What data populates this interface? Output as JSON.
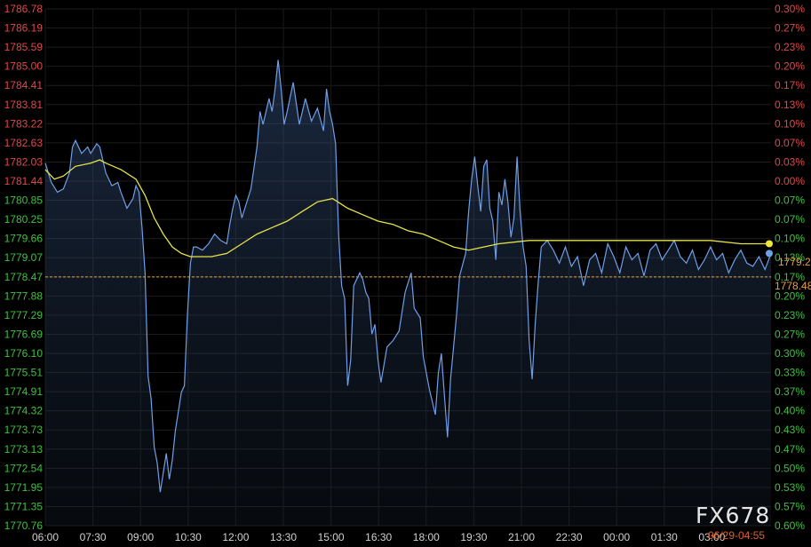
{
  "watermark": "FX678",
  "timestamp": "06/29-04:55",
  "chart_data": {
    "type": "line",
    "xlim": [
      0,
      24
    ],
    "ylim": [
      1770.76,
      1786.78
    ],
    "x_ticks": [
      "06:00",
      "07:30",
      "09:00",
      "10:30",
      "12:00",
      "13:30",
      "15:00",
      "16:30",
      "18:00",
      "19:30",
      "21:00",
      "22:30",
      "00:00",
      "01:30",
      "03:00"
    ],
    "y_ticks_left": [
      "1786.78",
      "1786.19",
      "1785.59",
      "1785.00",
      "1784.41",
      "1783.81",
      "1783.22",
      "1782.63",
      "1782.03",
      "1781.44",
      "1780.85",
      "1780.25",
      "1779.66",
      "1779.07",
      "1778.47",
      "1777.88",
      "1777.29",
      "1776.69",
      "1776.10",
      "1775.51",
      "1774.91",
      "1774.32",
      "1773.73",
      "1773.13",
      "1772.54",
      "1771.95",
      "1771.35",
      "1770.76"
    ],
    "y_ticks_right": [
      "0.30%",
      "0.27%",
      "0.23%",
      "0.20%",
      "0.17%",
      "0.13%",
      "0.10%",
      "0.07%",
      "0.03%",
      "0.00%",
      "0.07%",
      "0.07%",
      "0.10%",
      "0.13%",
      "0.17%",
      "0.20%",
      "0.23%",
      "0.27%",
      "0.30%",
      "0.33%",
      "0.37%",
      "0.40%",
      "0.43%",
      "0.47%",
      "0.50%",
      "0.53%",
      "0.57%",
      "0.60%"
    ],
    "reference_price": 1778.47,
    "reference_label": "1778.48",
    "last_price_label": "1779.2",
    "series": [
      {
        "values": [
          [
            0.0,
            1782.0
          ],
          [
            0.2,
            1781.4
          ],
          [
            0.4,
            1781.1
          ],
          [
            0.6,
            1781.2
          ],
          [
            0.8,
            1781.7
          ],
          [
            0.9,
            1782.5
          ],
          [
            1.0,
            1782.7
          ],
          [
            1.2,
            1782.3
          ],
          [
            1.4,
            1782.5
          ],
          [
            1.5,
            1782.3
          ],
          [
            1.7,
            1782.6
          ],
          [
            1.8,
            1782.5
          ],
          [
            2.0,
            1781.7
          ],
          [
            2.2,
            1781.3
          ],
          [
            2.4,
            1781.4
          ],
          [
            2.5,
            1781.1
          ],
          [
            2.7,
            1780.6
          ],
          [
            2.9,
            1780.9
          ],
          [
            3.0,
            1781.3
          ],
          [
            3.1,
            1781.1
          ],
          [
            3.2,
            1780.0
          ],
          [
            3.3,
            1778.6
          ],
          [
            3.4,
            1775.4
          ],
          [
            3.5,
            1774.7
          ],
          [
            3.6,
            1773.2
          ],
          [
            3.7,
            1772.7
          ],
          [
            3.8,
            1771.8
          ],
          [
            3.9,
            1772.4
          ],
          [
            4.0,
            1773.0
          ],
          [
            4.1,
            1772.2
          ],
          [
            4.2,
            1772.8
          ],
          [
            4.3,
            1773.7
          ],
          [
            4.4,
            1774.3
          ],
          [
            4.5,
            1774.9
          ],
          [
            4.6,
            1775.1
          ],
          [
            4.7,
            1777.3
          ],
          [
            4.8,
            1778.9
          ],
          [
            4.9,
            1779.4
          ],
          [
            5.0,
            1779.4
          ],
          [
            5.2,
            1779.3
          ],
          [
            5.4,
            1779.5
          ],
          [
            5.6,
            1779.8
          ],
          [
            5.8,
            1779.6
          ],
          [
            6.0,
            1779.5
          ],
          [
            6.1,
            1780.1
          ],
          [
            6.2,
            1780.6
          ],
          [
            6.3,
            1781.0
          ],
          [
            6.4,
            1780.8
          ],
          [
            6.5,
            1780.3
          ],
          [
            6.6,
            1780.6
          ],
          [
            6.8,
            1781.2
          ],
          [
            7.0,
            1782.5
          ],
          [
            7.1,
            1783.6
          ],
          [
            7.2,
            1783.2
          ],
          [
            7.4,
            1784.0
          ],
          [
            7.5,
            1783.6
          ],
          [
            7.6,
            1784.3
          ],
          [
            7.7,
            1785.2
          ],
          [
            7.8,
            1784.3
          ],
          [
            7.9,
            1783.2
          ],
          [
            8.0,
            1783.6
          ],
          [
            8.2,
            1784.5
          ],
          [
            8.4,
            1783.2
          ],
          [
            8.6,
            1784.0
          ],
          [
            8.8,
            1783.3
          ],
          [
            9.0,
            1783.7
          ],
          [
            9.2,
            1783.0
          ],
          [
            9.3,
            1784.3
          ],
          [
            9.4,
            1783.6
          ],
          [
            9.5,
            1783.2
          ],
          [
            9.6,
            1782.6
          ],
          [
            9.7,
            1779.8
          ],
          [
            9.8,
            1778.2
          ],
          [
            9.9,
            1777.8
          ],
          [
            10.0,
            1775.1
          ],
          [
            10.1,
            1775.9
          ],
          [
            10.2,
            1778.2
          ],
          [
            10.4,
            1778.6
          ],
          [
            10.5,
            1778.4
          ],
          [
            10.6,
            1778.0
          ],
          [
            10.7,
            1777.8
          ],
          [
            10.8,
            1776.7
          ],
          [
            10.9,
            1777.0
          ],
          [
            11.0,
            1775.9
          ],
          [
            11.1,
            1775.2
          ],
          [
            11.3,
            1776.3
          ],
          [
            11.5,
            1776.5
          ],
          [
            11.7,
            1776.8
          ],
          [
            11.9,
            1778.0
          ],
          [
            12.1,
            1778.6
          ],
          [
            12.2,
            1777.5
          ],
          [
            12.4,
            1777.2
          ],
          [
            12.5,
            1776.0
          ],
          [
            12.7,
            1775.0
          ],
          [
            12.9,
            1774.2
          ],
          [
            13.0,
            1775.5
          ],
          [
            13.1,
            1776.1
          ],
          [
            13.2,
            1774.8
          ],
          [
            13.3,
            1773.5
          ],
          [
            13.4,
            1775.3
          ],
          [
            13.5,
            1776.3
          ],
          [
            13.6,
            1777.3
          ],
          [
            13.7,
            1778.5
          ],
          [
            13.9,
            1779.2
          ],
          [
            14.0,
            1780.5
          ],
          [
            14.1,
            1781.5
          ],
          [
            14.2,
            1782.2
          ],
          [
            14.3,
            1781.3
          ],
          [
            14.4,
            1780.5
          ],
          [
            14.5,
            1781.9
          ],
          [
            14.6,
            1782.1
          ],
          [
            14.7,
            1780.6
          ],
          [
            14.8,
            1780.2
          ],
          [
            14.9,
            1779.0
          ],
          [
            15.0,
            1781.1
          ],
          [
            15.1,
            1780.7
          ],
          [
            15.2,
            1781.5
          ],
          [
            15.3,
            1780.8
          ],
          [
            15.4,
            1779.7
          ],
          [
            15.5,
            1780.3
          ],
          [
            15.6,
            1782.2
          ],
          [
            15.7,
            1780.5
          ],
          [
            15.8,
            1779.4
          ],
          [
            15.9,
            1778.8
          ],
          [
            16.0,
            1776.5
          ],
          [
            16.1,
            1775.3
          ],
          [
            16.2,
            1777.0
          ],
          [
            16.3,
            1778.3
          ],
          [
            16.4,
            1779.4
          ],
          [
            16.6,
            1779.6
          ],
          [
            16.8,
            1779.3
          ],
          [
            17.0,
            1778.9
          ],
          [
            17.2,
            1779.4
          ],
          [
            17.4,
            1778.8
          ],
          [
            17.6,
            1779.1
          ],
          [
            17.8,
            1778.2
          ],
          [
            18.0,
            1779.0
          ],
          [
            18.2,
            1779.2
          ],
          [
            18.4,
            1778.6
          ],
          [
            18.6,
            1779.5
          ],
          [
            18.8,
            1779.1
          ],
          [
            19.0,
            1778.6
          ],
          [
            19.2,
            1779.4
          ],
          [
            19.4,
            1779.0
          ],
          [
            19.6,
            1779.2
          ],
          [
            19.8,
            1778.5
          ],
          [
            20.0,
            1779.3
          ],
          [
            20.2,
            1779.5
          ],
          [
            20.4,
            1779.0
          ],
          [
            20.6,
            1779.3
          ],
          [
            20.8,
            1779.6
          ],
          [
            21.0,
            1779.1
          ],
          [
            21.2,
            1778.9
          ],
          [
            21.4,
            1779.3
          ],
          [
            21.6,
            1778.7
          ],
          [
            21.8,
            1779.0
          ],
          [
            22.0,
            1779.4
          ],
          [
            22.2,
            1779.0
          ],
          [
            22.4,
            1779.2
          ],
          [
            22.6,
            1778.6
          ],
          [
            22.8,
            1779.0
          ],
          [
            23.0,
            1779.3
          ],
          [
            23.2,
            1778.9
          ],
          [
            23.4,
            1778.8
          ],
          [
            23.6,
            1779.1
          ],
          [
            23.8,
            1778.7
          ],
          [
            24.0,
            1779.2
          ]
        ]
      },
      {
        "values": [
          [
            0.0,
            1781.8
          ],
          [
            0.3,
            1781.5
          ],
          [
            0.6,
            1781.6
          ],
          [
            1.0,
            1781.9
          ],
          [
            1.5,
            1782.0
          ],
          [
            1.8,
            1782.1
          ],
          [
            2.0,
            1782.0
          ],
          [
            2.5,
            1781.8
          ],
          [
            3.0,
            1781.5
          ],
          [
            3.3,
            1781.0
          ],
          [
            3.6,
            1780.3
          ],
          [
            3.9,
            1779.8
          ],
          [
            4.2,
            1779.4
          ],
          [
            4.5,
            1779.2
          ],
          [
            4.8,
            1779.1
          ],
          [
            5.5,
            1779.1
          ],
          [
            6.0,
            1779.2
          ],
          [
            6.5,
            1779.5
          ],
          [
            7.0,
            1779.8
          ],
          [
            7.5,
            1780.0
          ],
          [
            8.0,
            1780.2
          ],
          [
            8.5,
            1780.5
          ],
          [
            9.0,
            1780.8
          ],
          [
            9.5,
            1780.9
          ],
          [
            10.0,
            1780.6
          ],
          [
            10.5,
            1780.4
          ],
          [
            11.0,
            1780.2
          ],
          [
            11.5,
            1780.1
          ],
          [
            12.0,
            1779.9
          ],
          [
            12.5,
            1779.8
          ],
          [
            13.0,
            1779.6
          ],
          [
            13.5,
            1779.4
          ],
          [
            14.0,
            1779.3
          ],
          [
            14.5,
            1779.4
          ],
          [
            15.0,
            1779.5
          ],
          [
            16.0,
            1779.6
          ],
          [
            17.0,
            1779.6
          ],
          [
            18.0,
            1779.6
          ],
          [
            19.0,
            1779.6
          ],
          [
            20.0,
            1779.6
          ],
          [
            21.0,
            1779.6
          ],
          [
            22.0,
            1779.6
          ],
          [
            23.0,
            1779.5
          ],
          [
            24.0,
            1779.5
          ]
        ]
      }
    ]
  }
}
